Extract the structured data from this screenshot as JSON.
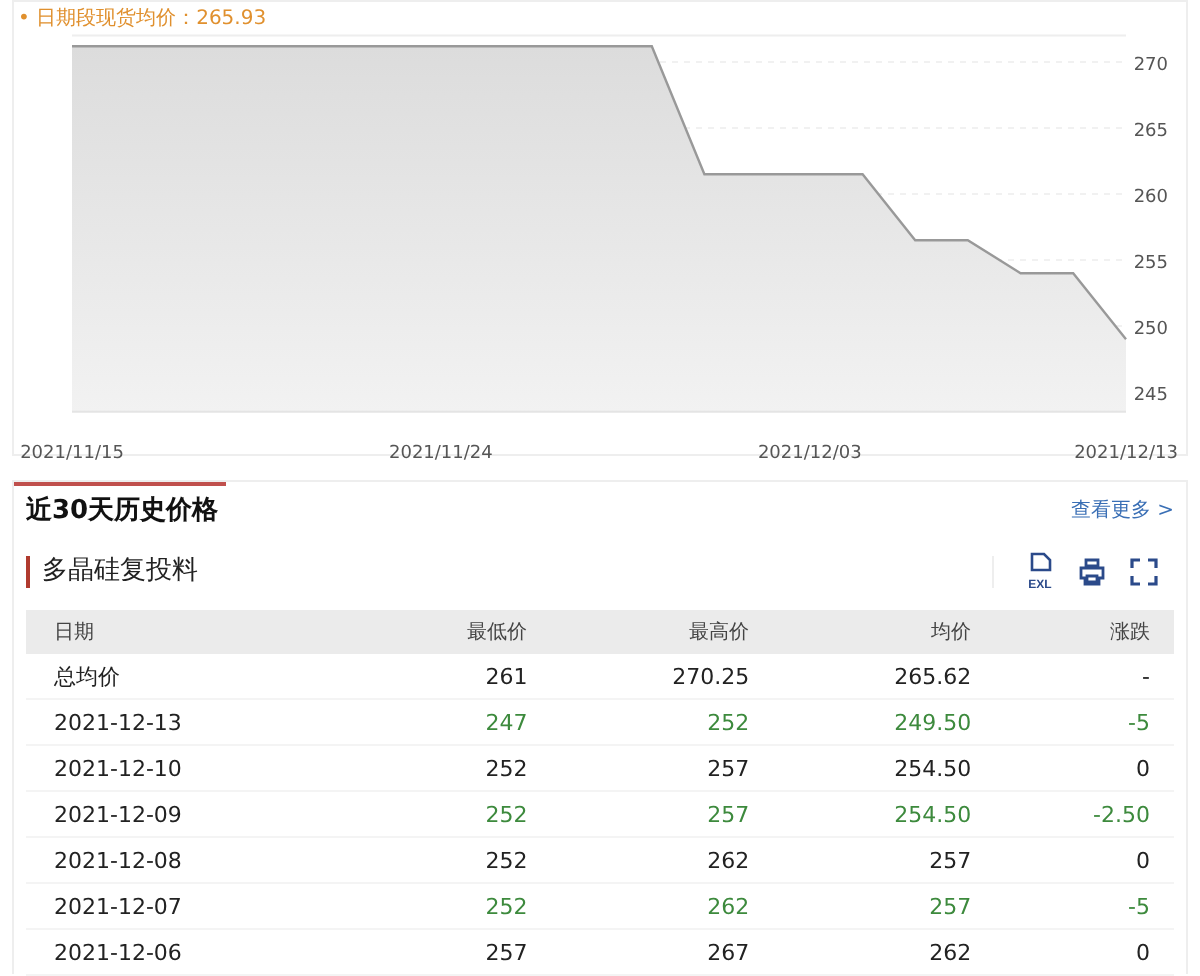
{
  "price_chart": {
    "legend": "• 日期段现货均价：265.93",
    "chart_data": {
      "type": "area",
      "grid": true,
      "categories": [
        "2021/11/15",
        null,
        null,
        null,
        null,
        null,
        null,
        "2021/11/24",
        null,
        null,
        null,
        null,
        null,
        null,
        "2021/12/03",
        null,
        null,
        null,
        null,
        null,
        "2021/12/13"
      ],
      "series": [
        {
          "color": "#999999",
          "values": [
            271.2,
            271.2,
            271.2,
            271.2,
            271.2,
            271.2,
            271.2,
            271.2,
            271.2,
            271.2,
            271.2,
            271.2,
            261.5,
            261.5,
            261.5,
            261.5,
            256.5,
            256.5,
            254,
            254,
            249
          ]
        }
      ],
      "ylim": [
        243.5,
        272
      ],
      "yticks": [
        245,
        250,
        255,
        260,
        265,
        270
      ]
    }
  },
  "history": {
    "tab": {
      "label": "近30天历史价格",
      "selected": true
    },
    "more_link": "查看更多 >",
    "product": "多晶硅复投料",
    "export_label": "EXL",
    "table": {
      "columns": [
        "日期",
        "最低价",
        "最高价",
        "均价",
        "涨跌"
      ],
      "rows": [
        {
          "falling": false,
          "cells": [
            "总均价",
            "261",
            "270.25",
            "265.62",
            "-"
          ]
        },
        {
          "falling": true,
          "cells": [
            "2021-12-13",
            "247",
            "252",
            "249.50",
            "-5"
          ]
        },
        {
          "falling": false,
          "cells": [
            "2021-12-10",
            "252",
            "257",
            "254.50",
            "0"
          ]
        },
        {
          "falling": true,
          "cells": [
            "2021-12-09",
            "252",
            "257",
            "254.50",
            "-2.50"
          ]
        },
        {
          "falling": false,
          "cells": [
            "2021-12-08",
            "252",
            "262",
            "257",
            "0"
          ]
        },
        {
          "falling": true,
          "cells": [
            "2021-12-07",
            "252",
            "262",
            "257",
            "-5"
          ]
        },
        {
          "falling": false,
          "cells": [
            "2021-12-06",
            "257",
            "267",
            "262",
            "0"
          ]
        }
      ]
    }
  }
}
